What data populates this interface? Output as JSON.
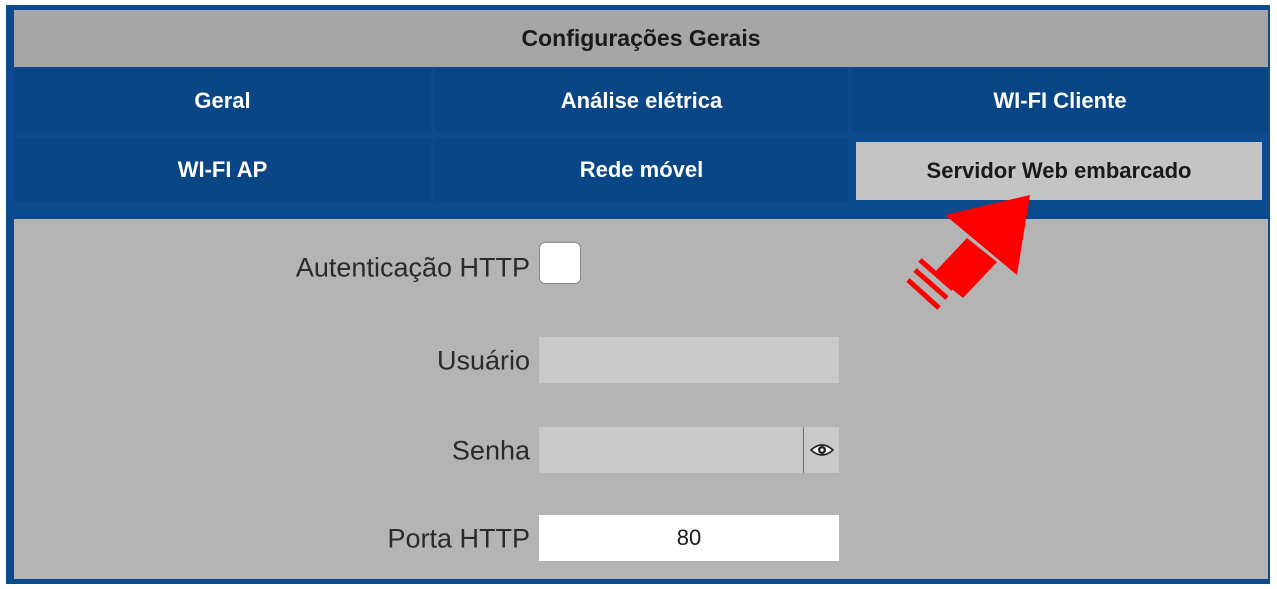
{
  "header": {
    "title": "Configurações Gerais"
  },
  "tabs": [
    {
      "label": "Geral"
    },
    {
      "label": "Análise elétrica"
    },
    {
      "label": "WI-FI Cliente"
    },
    {
      "label": "WI-FI AP"
    },
    {
      "label": "Rede móvel"
    },
    {
      "label": "Servidor Web embarcado",
      "active": true
    }
  ],
  "form": {
    "http_auth": {
      "label": "Autenticação HTTP",
      "checked": false
    },
    "user": {
      "label": "Usuário",
      "value": ""
    },
    "password": {
      "label": "Senha",
      "value": "",
      "icon": "eye-icon"
    },
    "http_port": {
      "label": "Porta HTTP",
      "value": "80"
    }
  },
  "colors": {
    "frame": "#0b4a8d",
    "tab_bg": "#0a4685",
    "tab_active_bg": "#c4c4c4",
    "header_bg": "#a6a6a6",
    "content_bg": "#b4b4b4",
    "annotation_arrow": "#ff0000"
  }
}
